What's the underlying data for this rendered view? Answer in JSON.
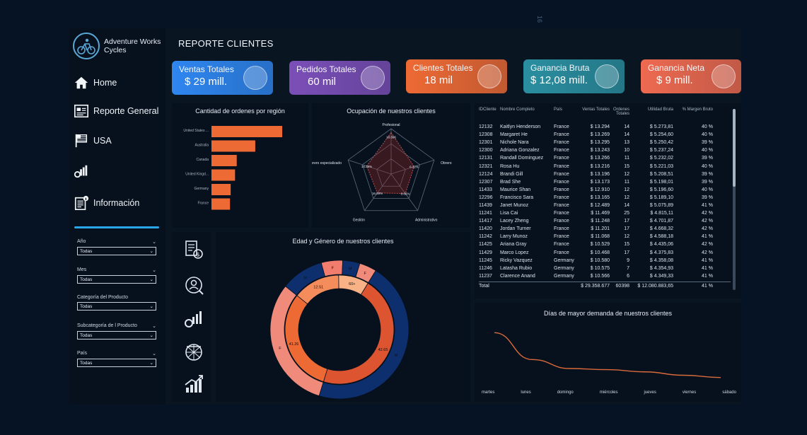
{
  "page_number": "16",
  "brand": {
    "name": "Adventure Works Cycles"
  },
  "nav": [
    {
      "label": "Home",
      "icon": "home-icon"
    },
    {
      "label": "Reporte General",
      "icon": "report-icon"
    },
    {
      "label": "USA",
      "icon": "flag-icon"
    },
    {
      "label": "",
      "icon": "chart-gear-icon"
    },
    {
      "label": "Información",
      "icon": "info-doc-icon"
    }
  ],
  "filters": [
    {
      "label": "Año",
      "value": "Todas"
    },
    {
      "label": "Mes",
      "value": "Todas"
    },
    {
      "label": "Categoría del Producto",
      "value": "Todas"
    },
    {
      "label": "Subcategoría de l Producto",
      "value": "Todas"
    },
    {
      "label": "País",
      "value": "Todas"
    }
  ],
  "title": "REPORTE CLIENTES",
  "kpis": [
    {
      "label": "Ventas Totales",
      "value": "$ 29 mill.",
      "color": "#2f86f0",
      "icon": "sales-icon"
    },
    {
      "label": "Pedidos Totales",
      "value": "60 mil",
      "color": "#7b4fb8",
      "icon": "orders-icon"
    },
    {
      "label": "Clientes Totales",
      "value": "18 mil",
      "color": "#ee6a35",
      "icon": "customers-icon"
    },
    {
      "label": "Ganancia Bruta",
      "value": "$ 12,08 mill.",
      "color": "#2a8fa0",
      "icon": "gross-profit-icon"
    },
    {
      "label": "Ganancia Neta",
      "value": "$ 9 mill.",
      "color": "#ee6a50",
      "icon": "net-profit-icon"
    }
  ],
  "chart_data": [
    {
      "type": "bar",
      "title": "Cantidad de ordenes por región",
      "categories": [
        "United States ...",
        "Australia",
        "Canada",
        "United Kingd...",
        "Germany",
        "France"
      ],
      "values": [
        21000,
        13000,
        7500,
        7000,
        5700,
        5500
      ],
      "color": "#ee6a35"
    },
    {
      "type": "radar",
      "title": "Ocupación de nuestros clientes",
      "categories": [
        "Profesional",
        "Obrero",
        "Administrativo",
        "Gestión",
        "Obrero especializado"
      ],
      "value_labels": [
        "18.896",
        "6.32%",
        "8.66%",
        "16.89%",
        "14.26%"
      ],
      "values": [
        5.5,
        3.2,
        3.2,
        3.1,
        3.4
      ]
    },
    {
      "type": "donut",
      "title": "Edad y Género de nuestros clientes",
      "outer": [
        {
          "label": "M",
          "value": 0.46,
          "color": "#0e2f6e"
        },
        {
          "label": "F",
          "value": 0.31,
          "color": "#f08a7a"
        },
        {
          "label": "M",
          "value": 0.1,
          "color": "#0e2f6e"
        },
        {
          "label": "F",
          "value": 0.05,
          "color": "#f07d6e"
        },
        {
          "label": "M",
          "value": 0.04,
          "color": "#0e2f6e"
        },
        {
          "label": "F",
          "value": 0.04,
          "color": "#f08a7a"
        }
      ],
      "inner": [
        {
          "label": "42.65",
          "value": 0.46,
          "color": "#dd5431"
        },
        {
          "label": "41.26",
          "value": 0.31,
          "color": "#ee6a35"
        },
        {
          "label": "12.51",
          "value": 0.14,
          "color": "#f58c5c"
        },
        {
          "label": "60+",
          "value": 0.09,
          "color": "#f9b186"
        }
      ]
    },
    {
      "type": "line",
      "title": "Días de mayor demanda de nuestros clientes",
      "categories": [
        "martes",
        "lunes",
        "domingo",
        "miércoles",
        "jueves",
        "viernes",
        "sábado"
      ],
      "values": [
        9200,
        8000,
        7600,
        7550,
        7450,
        7300,
        7200
      ],
      "color": "#d96a3b"
    }
  ],
  "table": {
    "headers": [
      "IDCliente",
      "Nombre Completo",
      "País",
      "Ventas Totales",
      "Ordenes Totales",
      "Utilidad Bruta",
      "% Margen Bruto"
    ],
    "rows": [
      [
        "12132",
        "Kaitlyn Henderson",
        "France",
        "$ 13.294",
        "14",
        "$ 5.273,81",
        "40 %"
      ],
      [
        "12308",
        "Margaret He",
        "France",
        "$ 13.269",
        "14",
        "$ 5.254,60",
        "40 %"
      ],
      [
        "12301",
        "Nichole Nara",
        "France",
        "$ 13.295",
        "13",
        "$ 5.250,42",
        "39 %"
      ],
      [
        "12300",
        "Adriana Gonzalez",
        "France",
        "$ 13.243",
        "10",
        "$ 5.237,24",
        "40 %"
      ],
      [
        "12131",
        "Randall Dominguez",
        "France",
        "$ 13.266",
        "11",
        "$ 5.232,02",
        "39 %"
      ],
      [
        "12321",
        "Rosa Hu",
        "France",
        "$ 13.216",
        "15",
        "$ 5.221,03",
        "40 %"
      ],
      [
        "12124",
        "Brandi Gill",
        "France",
        "$ 13.196",
        "12",
        "$ 5.208,51",
        "39 %"
      ],
      [
        "12307",
        "Brad She",
        "France",
        "$ 13.173",
        "11",
        "$ 5.198,01",
        "39 %"
      ],
      [
        "11433",
        "Maurice Shan",
        "France",
        "$ 12.910",
        "12",
        "$ 5.196,60",
        "40 %"
      ],
      [
        "12296",
        "Francisco Sara",
        "France",
        "$ 13.165",
        "12",
        "$ 5.189,10",
        "39 %"
      ],
      [
        "11439",
        "Janet Munoz",
        "France",
        "$ 12.489",
        "14",
        "$ 5.075,89",
        "41 %"
      ],
      [
        "11241",
        "Lisa Cai",
        "France",
        "$ 11.469",
        "25",
        "$ 4.815,11",
        "42 %"
      ],
      [
        "11417",
        "Lacey Zheng",
        "France",
        "$ 11.248",
        "17",
        "$ 4.701,87",
        "42 %"
      ],
      [
        "11420",
        "Jordan Turner",
        "France",
        "$ 11.201",
        "17",
        "$ 4.668,32",
        "42 %"
      ],
      [
        "11242",
        "Larry Munoz",
        "France",
        "$ 11.068",
        "12",
        "$ 4.588,18",
        "41 %"
      ],
      [
        "11425",
        "Ariana Gray",
        "France",
        "$ 10.529",
        "15",
        "$ 4.435,06",
        "42 %"
      ],
      [
        "11429",
        "Marco Lopez",
        "France",
        "$ 10.468",
        "17",
        "$ 4.375,83",
        "42 %"
      ],
      [
        "11245",
        "Ricky Vazquez",
        "Germany",
        "$ 10.580",
        "9",
        "$ 4.358,08",
        "41 %"
      ],
      [
        "11246",
        "Latasha Rubio",
        "Germany",
        "$ 10.575",
        "7",
        "$ 4.354,93",
        "41 %"
      ],
      [
        "11237",
        "Clarence Anand",
        "Germany",
        "$ 10.566",
        "6",
        "$ 4.349,33",
        "41 %"
      ]
    ],
    "total": [
      "Total",
      "",
      "",
      "$ 29.358.677",
      "60398",
      "$ 12.080.883,65",
      "41 %"
    ]
  }
}
